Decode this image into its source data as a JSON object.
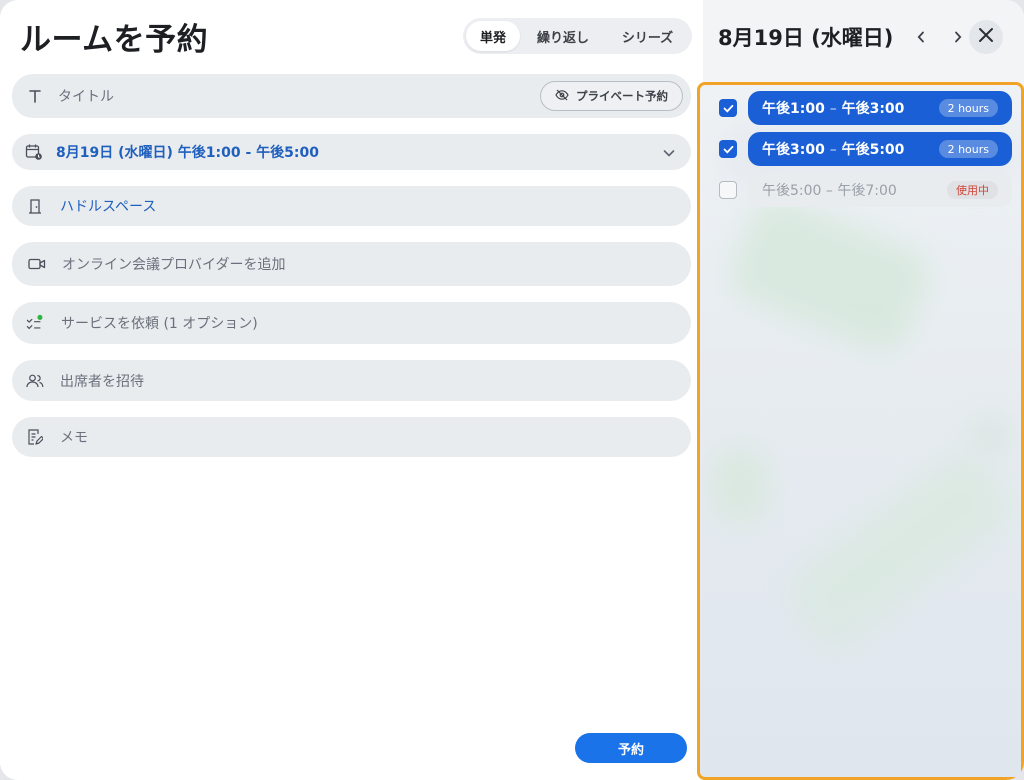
{
  "page_title": "ルームを予約",
  "booking_type": {
    "options": [
      "単発",
      "繰り返し",
      "シリーズ"
    ],
    "selected_index": 0
  },
  "form": {
    "title_placeholder": "タイトル",
    "private_label": "プライベート予約",
    "datetime": "8月19日 (水曜日) 午後1:00 - 午後5:00",
    "room": "ハドルスペース",
    "online_meeting": "オンライン会議プロバイダーを追加",
    "services": "サービスを依頼 (1 オプション)",
    "attendees": "出席者を招待",
    "memo": "メモ"
  },
  "submit_label": "予約",
  "schedule": {
    "date_title": "8月19日 (水曜日)",
    "slots": [
      {
        "start": "午後1:00",
        "sep": "–",
        "end": "午後3:00",
        "badge": "2 hours",
        "checked": true,
        "state": "selected"
      },
      {
        "start": "午後3:00",
        "sep": "–",
        "end": "午後5:00",
        "badge": "2 hours",
        "checked": true,
        "state": "selected"
      },
      {
        "start": "午後5:00",
        "sep": "–",
        "end": "午後7:00",
        "badge": "使用中",
        "checked": false,
        "state": "busy"
      }
    ]
  },
  "icons": {
    "title": "text-icon",
    "private": "eye-off-icon",
    "datetime": "calendar-clock-icon",
    "room": "door-icon",
    "online": "video-icon",
    "services": "checklist-icon",
    "attendees": "people-icon",
    "memo": "note-edit-icon",
    "prev": "chevron-left-icon",
    "next": "chevron-right-icon",
    "close": "close-icon"
  },
  "colors": {
    "accent": "#1a73e8",
    "selected_slot": "#1a5fd6",
    "highlight_border": "#f0a326",
    "busy_text": "#d0453a",
    "services_dot": "#2fb344"
  }
}
